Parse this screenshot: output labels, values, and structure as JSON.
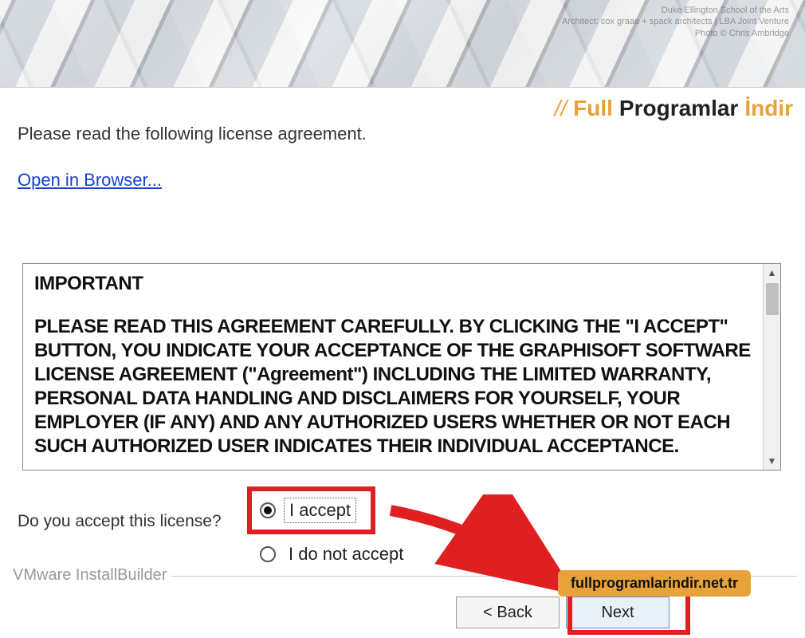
{
  "header": {
    "credits_l1": "Duke Ellington School of the Arts",
    "credits_l2": "Architect: cox graae + spack architects | LBA Joint Venture",
    "credits_l3": "Photo © Chris Ambridge"
  },
  "watermark": {
    "w1": "Full",
    "w2": "Programlar",
    "w3": "İndir"
  },
  "instruction": "Please read the following license agreement.",
  "open_browser": "Open in Browser...",
  "license": {
    "heading": "IMPORTANT",
    "body": "PLEASE READ THIS AGREEMENT CAREFULLY. BY CLICKING THE \"I ACCEPT\" BUTTON, YOU INDICATE YOUR ACCEPTANCE OF THE GRAPHISOFT SOFTWARE LICENSE AGREEMENT (\"Agreement\") INCLUDING THE LIMITED WARRANTY, PERSONAL DATA HANDLING AND DISCLAIMERS FOR YOURSELF, YOUR EMPLOYER (IF ANY) AND ANY AUTHORIZED USERS WHETHER OR NOT EACH SUCH AUTHORIZED USER INDICATES THEIR INDIVIDUAL ACCEPTANCE."
  },
  "accept_question": "Do you accept this license?",
  "radios": {
    "accept": "I accept",
    "decline": "I do not accept"
  },
  "footer": {
    "builder": "VMware InstallBuilder"
  },
  "buttons": {
    "back": "< Back",
    "next": "Next"
  },
  "url_badge": "fullprogramlarindir.net.tr"
}
